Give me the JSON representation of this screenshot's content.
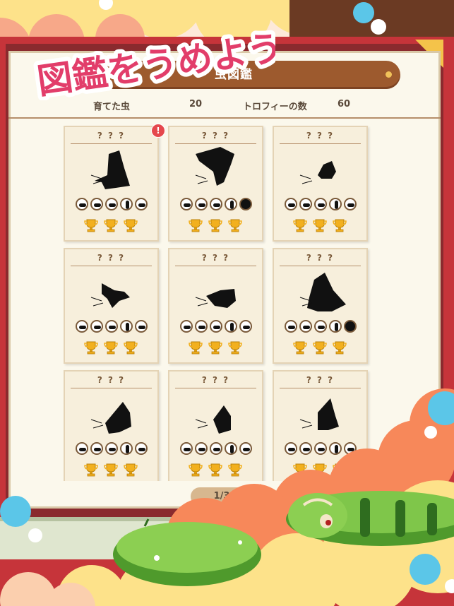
{
  "headline": "図鑑をうめよう!",
  "title_bar": {
    "title": "虫図鑑"
  },
  "stats": {
    "raised_label": "育てた虫",
    "raised_value": "20",
    "trophy_label": "トロフィーの数",
    "trophy_value": "60"
  },
  "cards": [
    {
      "name": "? ? ?"
    },
    {
      "name": "? ? ?"
    },
    {
      "name": "? ? ?"
    },
    {
      "name": "? ? ?"
    },
    {
      "name": "? ? ?"
    },
    {
      "name": "? ? ?"
    },
    {
      "name": "? ? ?"
    },
    {
      "name": "? ? ?"
    },
    {
      "name": "? ? ?"
    }
  ],
  "badge": "!",
  "pager": {
    "page": "1/3"
  },
  "colors": {
    "title_bar": "#9d5a2e",
    "panel": "#fbf8ec",
    "frame": "#c6343a",
    "badge": "#e5484d",
    "arrow": "#f4b21c",
    "cloud_orange": "#f7885a",
    "cloud_yellow": "#fde28a"
  }
}
